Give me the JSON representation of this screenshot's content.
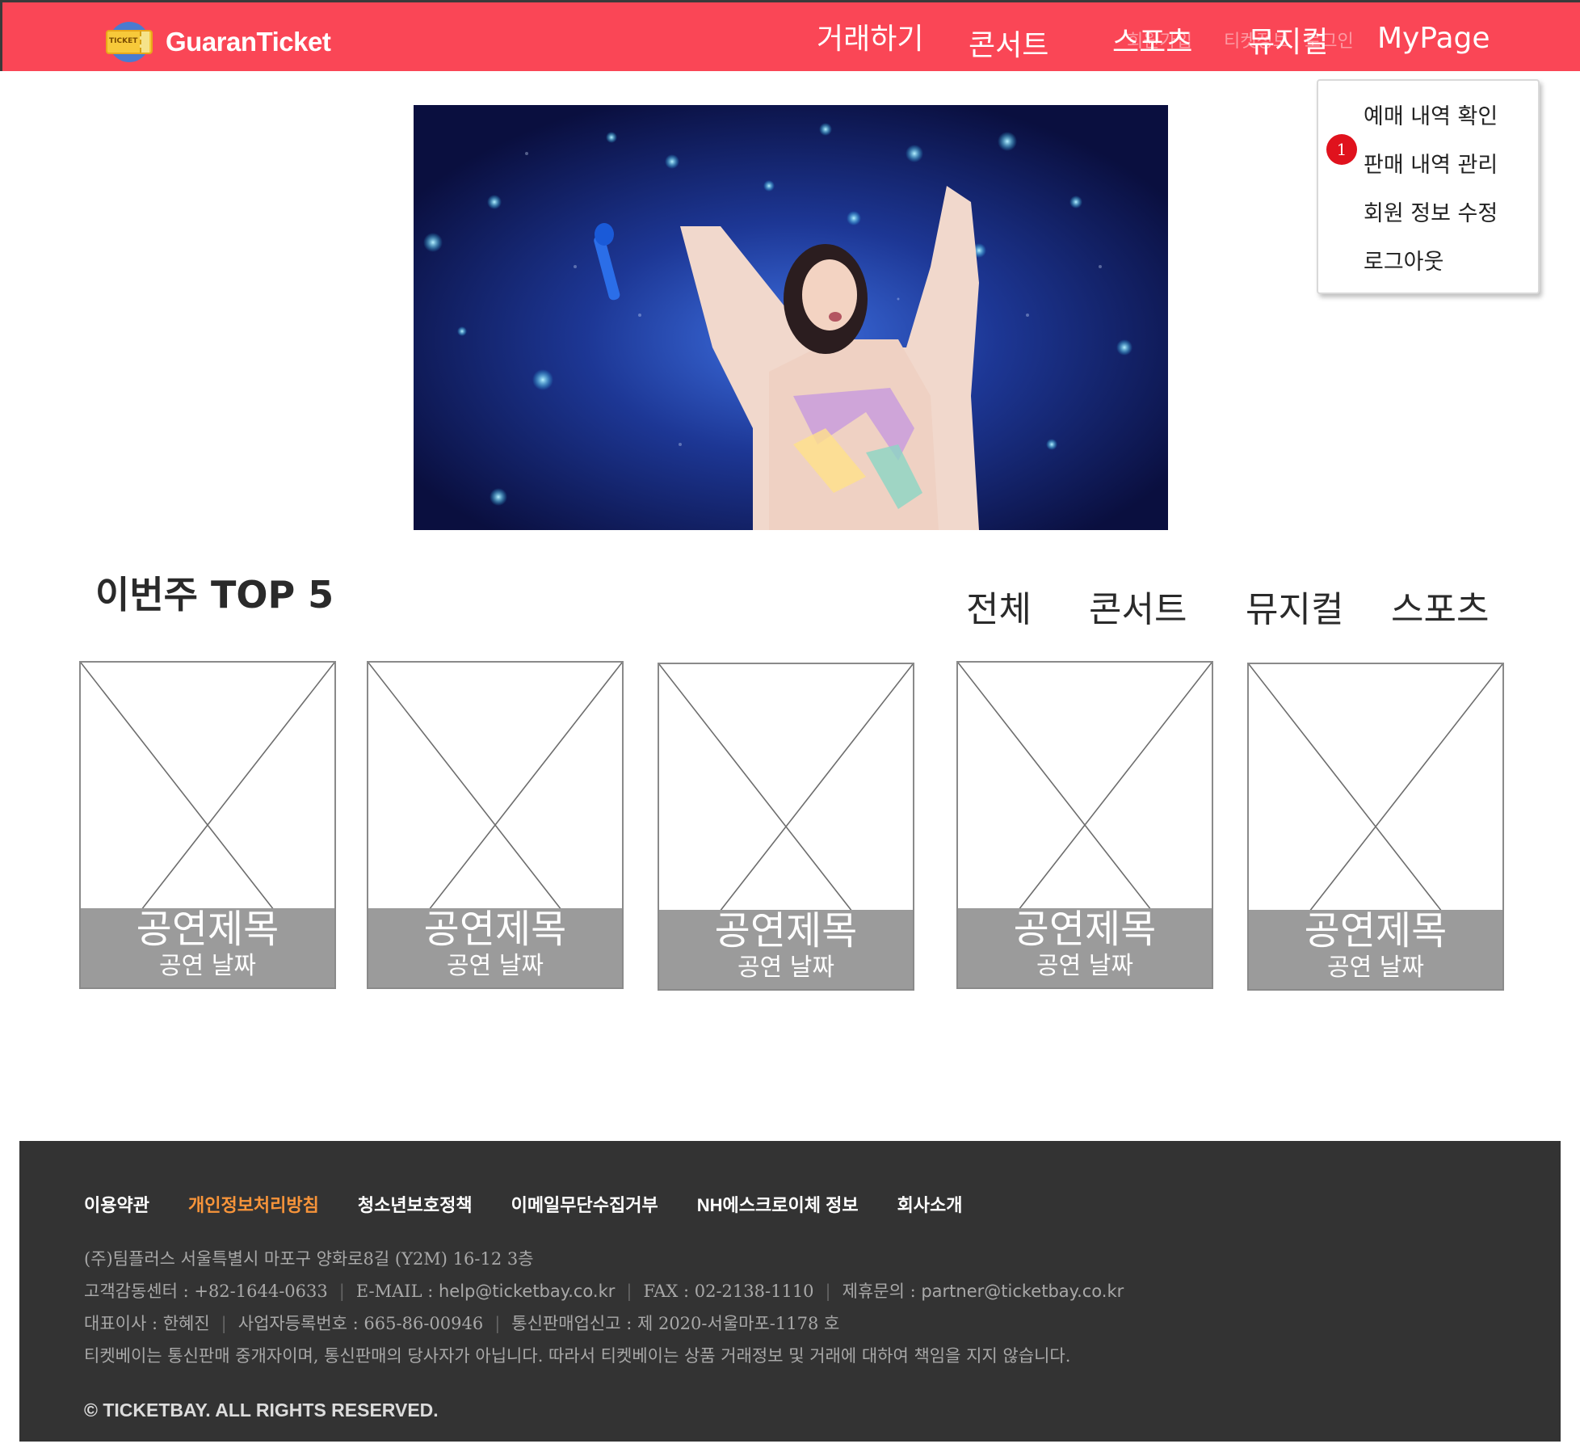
{
  "header": {
    "logo_text": "GuaranTicket",
    "logo_icon_text": "TICKET",
    "nav": [
      {
        "label": "거래하기"
      },
      {
        "label": "콘서트"
      },
      {
        "label": "스포츠"
      },
      {
        "label": "뮤지컬"
      },
      {
        "label": "MyPage"
      }
    ],
    "ghost_labels": [
      "회원가입",
      "티켓정보",
      "로그인"
    ]
  },
  "mypage_menu": {
    "badge": "1",
    "items": [
      "예매 내역 확인",
      "판매 내역 관리",
      "회원 정보 수정",
      "로그아웃"
    ]
  },
  "top5": {
    "title": "이번주 TOP 5",
    "tabs": [
      "전체",
      "콘서트",
      "뮤지컬",
      "스포츠"
    ],
    "cards": [
      {
        "title": "공연제목",
        "date": "공연 날짜"
      },
      {
        "title": "공연제목",
        "date": "공연 날짜"
      },
      {
        "title": "공연제목",
        "date": "공연 날짜"
      },
      {
        "title": "공연제목",
        "date": "공연 날짜"
      },
      {
        "title": "공연제목",
        "date": "공연 날짜"
      }
    ]
  },
  "footer": {
    "links": [
      "이용약관",
      "개인정보처리방침",
      "청소년보호정책",
      "이메일무단수집거부",
      "NH에스크로이체 정보",
      "회사소개"
    ],
    "address": "(주)팀플러스 서울특별시 마포구 양화로8길 (Y2M) 16-12 3층",
    "cs_center": "고객감동센터 : +82-1644-0633",
    "email_label": "E-MAIL : ",
    "email": "help@ticketbay.co.kr",
    "fax": "FAX : 02-2138-1110",
    "partner_label": "제휴문의 : ",
    "partner_email": "partner@ticketbay.co.kr",
    "ceo": "대표이사 : 한혜진",
    "biz_no": "사업자등록번호 : 665-86-00946",
    "mail_order": "통신판매업신고 : 제 2020-서울마포-1178 호",
    "disclaimer": "티켓베이는 통신판매 중개자이며, 통신판매의 당사자가 아닙니다. 따라서 티켓베이는 상품 거래정보 및 거래에 대하여 책임을 지지 않습니다.",
    "copyright": "© TICKETBAY. ALL RIGHTS RESERVED."
  },
  "colors": {
    "header_bg": "#fa4656",
    "footer_bg": "#333333",
    "footer_highlight": "#f7943a",
    "badge": "#e0121d",
    "card_caption": "#9b9b9b"
  }
}
